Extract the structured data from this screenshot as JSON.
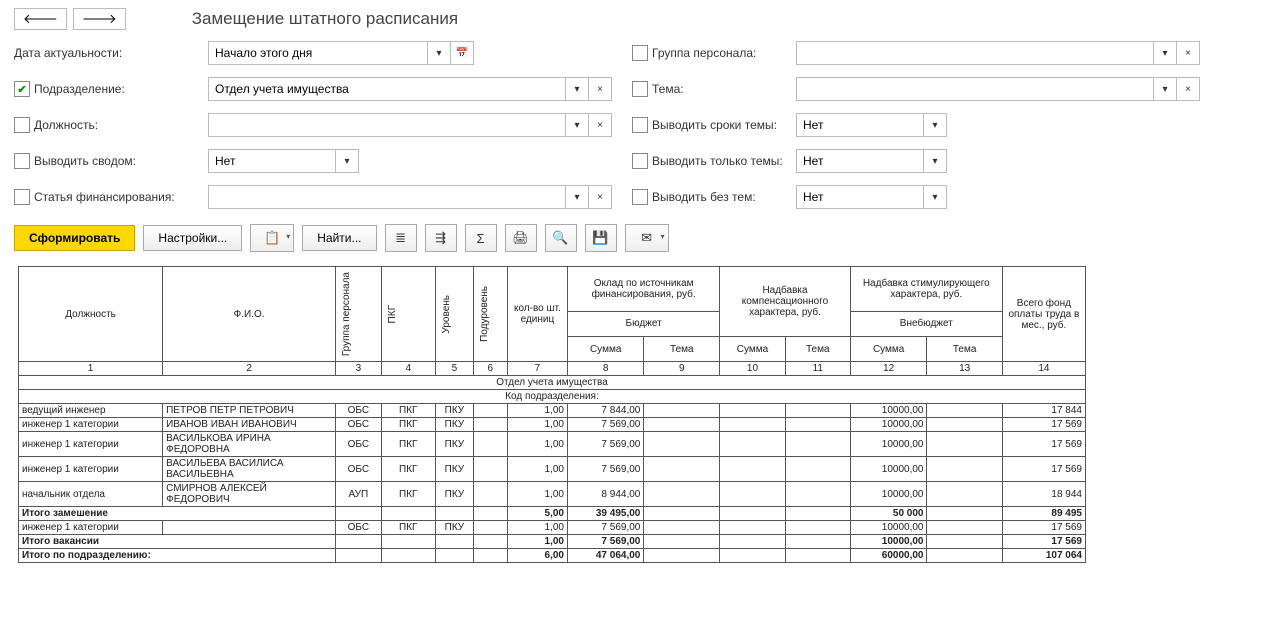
{
  "header": {
    "title": "Замещение штатного расписания"
  },
  "filters": {
    "date_label": "Дата актуальности:",
    "date_value": "Начало этого дня",
    "dept_label": "Подразделение:",
    "dept_checked": true,
    "dept_value": "Отдел учета имущества",
    "position_label": "Должность:",
    "summary_label": "Выводить сводом:",
    "summary_value": "Нет",
    "finance_label": "Статья финансирования:",
    "group_label": "Группа персонала:",
    "theme_label": "Тема:",
    "theme_terms_label": "Выводить сроки темы:",
    "theme_terms_value": "Нет",
    "only_themes_label": "Выводить только темы:",
    "only_themes_value": "Нет",
    "no_themes_label": "Выводить без тем:",
    "no_themes_value": "Нет"
  },
  "toolbar": {
    "generate": "Сформировать",
    "settings": "Настройки...",
    "find": "Найти..."
  },
  "table": {
    "headers": {
      "position": "Должность",
      "fio": "Ф.И.О.",
      "group": "Группа персонала",
      "pkg": "ПКГ",
      "level": "Уровень",
      "sublevel": "Подуровень",
      "units": "кол-во шт. единиц",
      "salary_group": "Оклад по источникам финансирования, руб.",
      "budget": "Бюджет",
      "comp_allowance": "Надбавка компенсационного характера, руб.",
      "stim_allowance": "Надбавка стимулирующего характера, руб.",
      "offbudget": "Внебюджет",
      "total": "Всего фонд оплаты труда в мес., руб.",
      "sum": "Сумма",
      "theme": "Тема"
    },
    "col_nums": [
      "1",
      "2",
      "3",
      "4",
      "5",
      "6",
      "7",
      "8",
      "9",
      "10",
      "11",
      "12",
      "13",
      "14"
    ],
    "section": "Отдел учета имущества",
    "section_code": "Код подразделения:",
    "rows": [
      {
        "pos": "ведущий инженер",
        "fio": "ПЕТРОВ ПЕТР ПЕТРОВИЧ",
        "grp": "ОБС",
        "pkg": "ПКГ",
        "lvl": "ПКУ",
        "sub": "",
        "units": "1,00",
        "s8": "7 844,00",
        "s9": "",
        "s10": "",
        "s11": "",
        "s12": "10000,00",
        "s13": "",
        "s14": "17 844"
      },
      {
        "pos": "инженер 1 категории",
        "fio": "ИВАНОВ ИВАН ИВАНОВИЧ",
        "grp": "ОБС",
        "pkg": "ПКГ",
        "lvl": "ПКУ",
        "sub": "",
        "units": "1,00",
        "s8": "7 569,00",
        "s9": "",
        "s10": "",
        "s11": "",
        "s12": "10000,00",
        "s13": "",
        "s14": "17 569"
      },
      {
        "pos": "инженер 1 категории",
        "fio": "ВАСИЛЬКОВА ИРИНА ФЕДОРОВНА",
        "grp": "ОБС",
        "pkg": "ПКГ",
        "lvl": "ПКУ",
        "sub": "",
        "units": "1,00",
        "s8": "7 569,00",
        "s9": "",
        "s10": "",
        "s11": "",
        "s12": "10000,00",
        "s13": "",
        "s14": "17 569"
      },
      {
        "pos": "инженер 1 категории",
        "fio": "ВАСИЛЬЕВА ВАСИЛИСА ВАСИЛЬЕВНА",
        "grp": "ОБС",
        "pkg": "ПКГ",
        "lvl": "ПКУ",
        "sub": "",
        "units": "1,00",
        "s8": "7 569,00",
        "s9": "",
        "s10": "",
        "s11": "",
        "s12": "10000,00",
        "s13": "",
        "s14": "17 569"
      },
      {
        "pos": "начальник отдела",
        "fio": "СМИРНОВ АЛЕКСЕЙ ФЕДОРОВИЧ",
        "grp": "АУП",
        "pkg": "ПКГ",
        "lvl": "ПКУ",
        "sub": "",
        "units": "1,00",
        "s8": "8 944,00",
        "s9": "",
        "s10": "",
        "s11": "",
        "s12": "10000,00",
        "s13": "",
        "s14": "18 944"
      }
    ],
    "subtotal1": {
      "label": "Итого замешение",
      "units": "5,00",
      "s8": "39 495,00",
      "s12": "50 000",
      "s14": "89 495"
    },
    "row_vac": {
      "pos": "инженер 1 категории",
      "fio": "",
      "grp": "ОБС",
      "pkg": "ПКГ",
      "lvl": "ПКУ",
      "sub": "",
      "units": "1,00",
      "s8": "7 569,00",
      "s9": "",
      "s10": "",
      "s11": "",
      "s12": "10000,00",
      "s13": "",
      "s14": "17 569"
    },
    "subtotal2": {
      "label": "Итого вакансии",
      "units": "1,00",
      "s8": "7 569,00",
      "s12": "10000,00",
      "s14": "17 569"
    },
    "total_row": {
      "label": "Итого по подразделению:",
      "units": "6,00",
      "s8": "47 064,00",
      "s12": "60000,00",
      "s14": "107 064"
    }
  }
}
